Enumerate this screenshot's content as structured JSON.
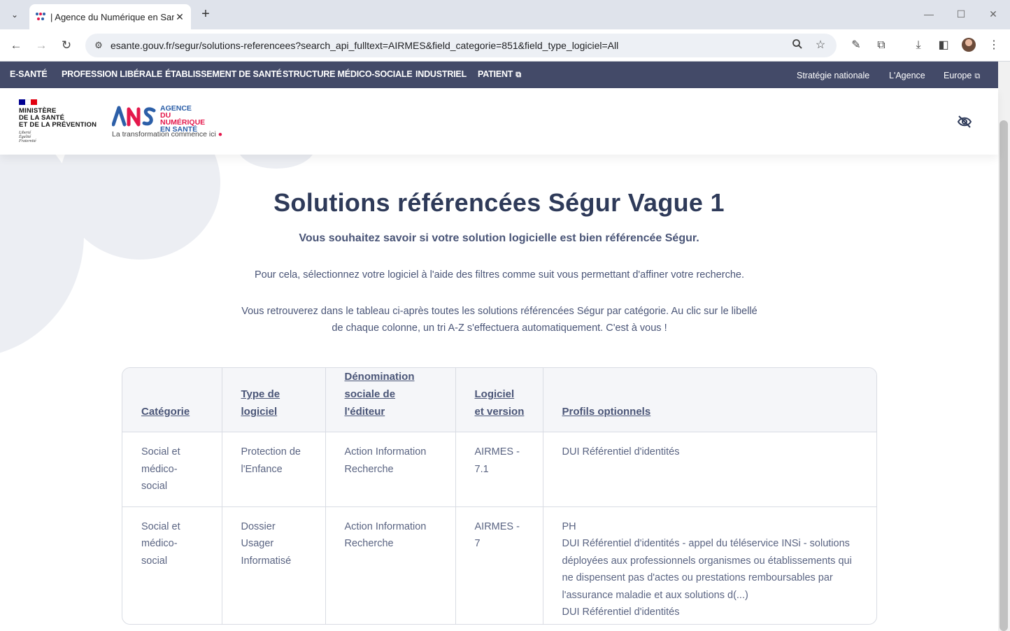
{
  "browser": {
    "tab_title": "| Agence du Numérique en Santé",
    "url": "esante.gouv.fr/segur/solutions-referencees?search_api_fulltext=AIRMES&field_categorie=851&field_type_logiciel=All"
  },
  "nav": {
    "items": [
      "E-SANTÉ",
      "PROFESSION LIBÉRALE",
      "ÉTABLISSEMENT DE SANTÉ",
      "STRUCTURE MÉDICO-SOCIALE",
      "INDUSTRIEL",
      "PATIENT"
    ],
    "right": [
      "Stratégie nationale",
      "L'Agence",
      "Europe"
    ]
  },
  "header": {
    "ministere": [
      "MINISTÈRE",
      "DE LA SANTÉ",
      "ET DE LA PRÉVENTION"
    ],
    "devise": [
      "Liberté",
      "Égalité",
      "Fraternité"
    ],
    "ans_text": [
      "AGENCE",
      "DU NUMÉRIQUE",
      "EN SANTÉ"
    ],
    "tagline": "La transformation commence ici"
  },
  "main": {
    "title": "Solutions référencées Ségur Vague 1",
    "subtitle": "Vous souhaitez savoir si votre solution logicielle est bien référencée Ségur.",
    "para1": "Pour cela, sélectionnez votre logiciel à l'aide des filtres comme suit vous permettant d'affiner votre recherche.",
    "para2": "Vous retrouverez dans le tableau ci-après toutes les solutions référencées Ségur par catégorie. Au clic sur le libellé de chaque colonne, un tri A-Z s'effectuera automatiquement. C'est à vous !"
  },
  "table": {
    "headers": [
      "Catégorie",
      "Type de logiciel",
      "Dénomination sociale de l'éditeur",
      "Logiciel et version",
      "Profils optionnels"
    ],
    "rows": [
      {
        "categorie": "Social et médico-social",
        "type": "Protection de l'Enfance",
        "editeur": "Action Information Recherche",
        "logiciel": "AIRMES - 7.1",
        "profils": [
          "DUI Référentiel d'identités"
        ]
      },
      {
        "categorie": "Social et médico-social",
        "type": "Dossier Usager Informatisé",
        "editeur": "Action Information Recherche",
        "logiciel": "AIRMES - 7",
        "profils": [
          "PH",
          "DUI Référentiel d'identités - appel du téléservice INSi - solutions déployées aux professionnels organismes ou établissements qui ne dispensent pas d'actes ou prestations remboursables par l'assurance maladie et aux solutions d(...)",
          "DUI Référentiel d'identités"
        ]
      }
    ]
  },
  "colors": {
    "nav_bg": "#434a68",
    "title": "#2e3a59",
    "text": "#4a5577",
    "ans_blue": "#2c5fa8",
    "ans_pink": "#e4174b",
    "flag_blue": "#000091",
    "flag_red": "#e1000f"
  }
}
